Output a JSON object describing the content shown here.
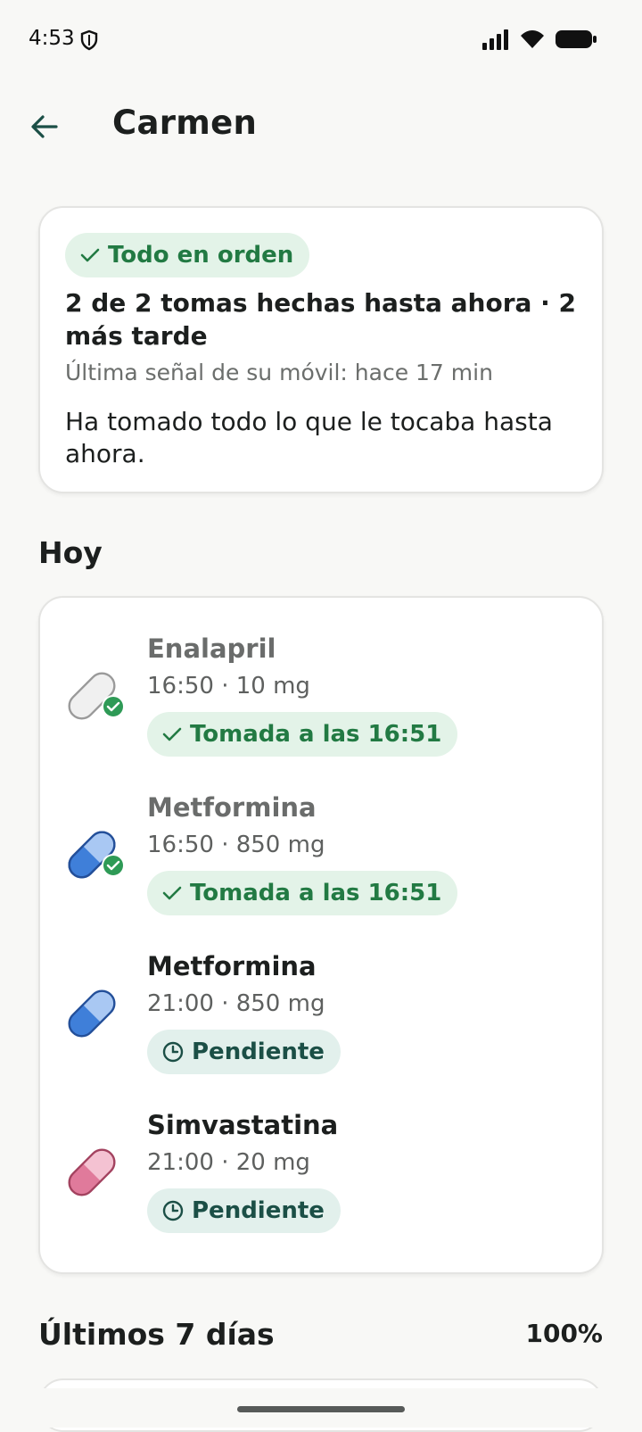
{
  "status_bar": {
    "time": "4:53"
  },
  "header": {
    "title": "Carmen"
  },
  "summary": {
    "badge": "Todo en orden",
    "headline": "2 de 2 tomas hechas hasta ahora · 2 más tarde",
    "last_signal": "Última señal de su móvil: hace 17 min",
    "message": "Ha tomado todo lo que le tocaba hasta ahora."
  },
  "today": {
    "title": "Hoy",
    "items": [
      {
        "name": "Enalapril",
        "detail": "16:50 · 10 mg",
        "status": "Tomada a las 16:51",
        "done": true,
        "pill_color": "#f0f0f0"
      },
      {
        "name": "Metformina",
        "detail": "16:50 · 850 mg",
        "status": "Tomada a las 16:51",
        "done": true,
        "pill_color": "#3f7fd9"
      },
      {
        "name": "Metformina",
        "detail": "21:00 · 850 mg",
        "status": "Pendiente",
        "done": false,
        "pill_color": "#3f7fd9"
      },
      {
        "name": "Simvastatina",
        "detail": "21:00 · 20 mg",
        "status": "Pendiente",
        "done": false,
        "pill_color": "#e07a9b"
      }
    ]
  },
  "last_7_days": {
    "title": "Últimos 7 días",
    "percent": "100%"
  },
  "colors": {
    "ok_green": "#227a43",
    "ok_bg": "#e3f3e8",
    "pending_teal": "#1b4f46",
    "pending_bg": "#e2f0ec"
  }
}
